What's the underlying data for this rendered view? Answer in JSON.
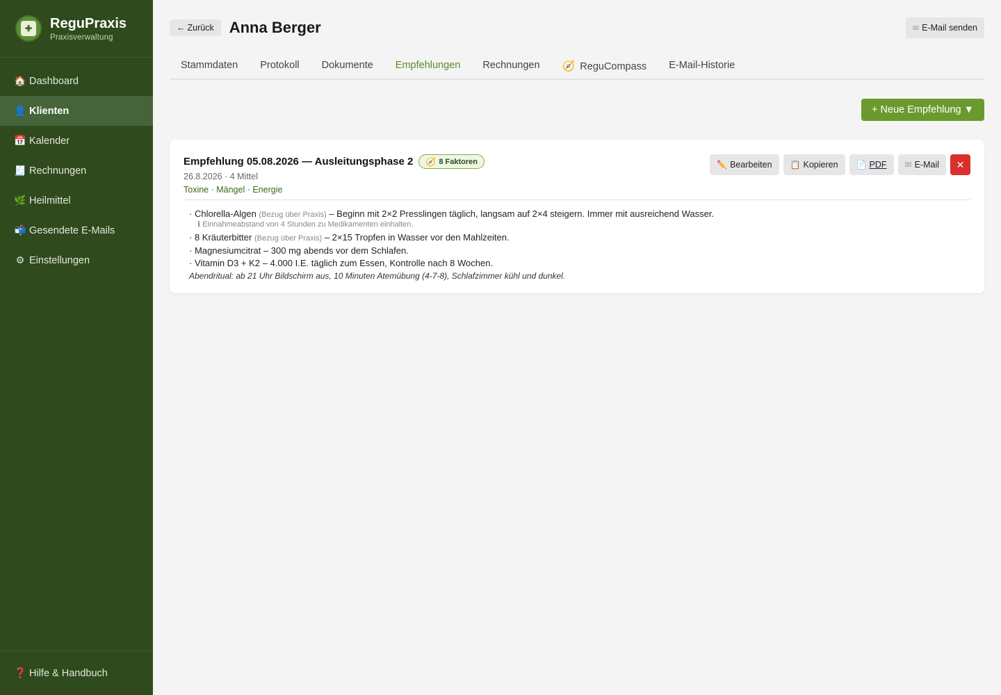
{
  "app": {
    "name": "ReguPraxis",
    "subtitle": "Praxisverwaltung"
  },
  "sidebar": {
    "items": [
      {
        "label": "Dashboard",
        "icon": "🏠"
      },
      {
        "label": "Klienten",
        "icon": "👤"
      },
      {
        "label": "Kalender",
        "icon": "📅"
      },
      {
        "label": "Rechnungen",
        "icon": "🧾"
      },
      {
        "label": "Heilmittel",
        "icon": "🌿"
      },
      {
        "label": "Gesendete E-Mails",
        "icon": "📬"
      },
      {
        "label": "Einstellungen",
        "icon": "⚙"
      }
    ],
    "help": {
      "label": "Hilfe & Handbuch",
      "icon": "❓"
    }
  },
  "header": {
    "back_label": "Zurück",
    "client_name": "Anna Berger",
    "email_button": "E-Mail senden"
  },
  "tabs": [
    {
      "label": "Stammdaten"
    },
    {
      "label": "Protokoll"
    },
    {
      "label": "Dokumente"
    },
    {
      "label": "Empfehlungen"
    },
    {
      "label": "Rechnungen"
    },
    {
      "label": "ReguCompass"
    },
    {
      "label": "E-Mail-Historie"
    }
  ],
  "new_button": "+ Neue Empfehlung ▼",
  "recommendation": {
    "title": "Empfehlung 05.08.2026 — Ausleitungsphase 2",
    "badge": "8 Faktoren",
    "meta": "26.8.2026 · 4 Mittel",
    "tags": "Toxine · Mängel · Energie",
    "actions": {
      "edit": "Bearbeiten",
      "copy": "Kopieren",
      "pdf": "PDF",
      "email": "E-Mail",
      "delete": "✕"
    },
    "items": [
      {
        "name": "Chlorella-Algen",
        "source": "(Bezug über Praxis)",
        "text": "– Beginn mit 2×2 Presslingen täglich, langsam auf 2×4 steigern. Immer mit ausreichend Wasser.",
        "hint": "Einnahmeabstand von 4 Stunden zu Medikamenten einhalten."
      },
      {
        "name": "8 Kräuterbitter",
        "source": "(Bezug über Praxis)",
        "text": "– 2×15 Tropfen in Wasser vor den Mahlzeiten."
      },
      {
        "name": "Magnesiumcitrat",
        "text": "– 300 mg abends vor dem Schlafen."
      },
      {
        "name": "Vitamin D3 + K2",
        "text": "– 4.000 I.E. täglich zum Essen, Kontrolle nach 8 Wochen."
      }
    ],
    "note": "Abendritual: ab 21 Uhr Bildschirm aus, 10 Minuten Atemübung (4-7-8), Schlafzimmer kühl und dunkel."
  },
  "colors": {
    "sidebar": "#2f4a1c",
    "accent": "#6a9a2e",
    "active_tab": "#5b8a26",
    "danger": "#d9302c"
  }
}
